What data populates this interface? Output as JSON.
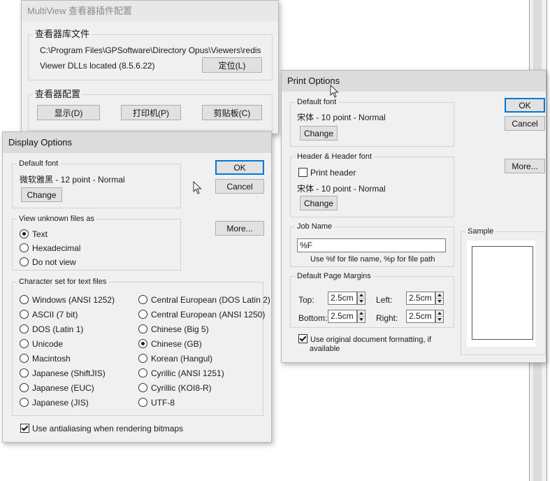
{
  "multiview": {
    "title": "MultiView 查看器插件配置",
    "lib_group": "查看器库文件",
    "path": "C:\\Program Files\\GPSoftware\\Directory Opus\\Viewers\\redis",
    "dll_status": "Viewer DLLs located (8.5.6.22)",
    "locate_button": "定位(L)",
    "config_group": "查看器配置",
    "display_button": "显示(D)",
    "printer_button": "打印机(P)",
    "clipboard_button": "剪贴板(C)"
  },
  "display": {
    "title": "Display Options",
    "default_font_group": "Default font",
    "font_value": "微软雅黑 - 12 point - Normal",
    "change_button": "Change",
    "ok_button": "OK",
    "cancel_button": "Cancel",
    "more_button": "More...",
    "view_unknown_group": "View unknown files as",
    "view_options": [
      {
        "label": "Text",
        "selected": true
      },
      {
        "label": "Hexadecimal",
        "selected": false
      },
      {
        "label": "Do not view",
        "selected": false
      }
    ],
    "charset_group": "Character set for text files",
    "charset_left": [
      {
        "label": "Windows (ANSI 1252)",
        "selected": false
      },
      {
        "label": "ASCII (7 bit)",
        "selected": false
      },
      {
        "label": "DOS (Latin 1)",
        "selected": false
      },
      {
        "label": "Unicode",
        "selected": false
      },
      {
        "label": "Macintosh",
        "selected": false
      },
      {
        "label": "Japanese (ShiftJIS)",
        "selected": false
      },
      {
        "label": "Japanese (EUC)",
        "selected": false
      },
      {
        "label": "Japanese (JIS)",
        "selected": false
      }
    ],
    "charset_right": [
      {
        "label": "Central European (DOS Latin 2)",
        "selected": false
      },
      {
        "label": "Central European (ANSI 1250)",
        "selected": false
      },
      {
        "label": "Chinese (Big 5)",
        "selected": false
      },
      {
        "label": "Chinese (GB)",
        "selected": true
      },
      {
        "label": "Korean (Hangul)",
        "selected": false
      },
      {
        "label": "Cyrillic (ANSI 1251)",
        "selected": false
      },
      {
        "label": "Cyrillic (KOI8-R)",
        "selected": false
      },
      {
        "label": "UTF-8",
        "selected": false
      }
    ],
    "antialias_label": "Use antialiasing when rendering bitmaps",
    "antialias_checked": true
  },
  "print": {
    "title": "Print Options",
    "default_font_group": "Default font",
    "font_value": "宋体 - 10 point - Normal",
    "change_button": "Change",
    "ok_button": "OK",
    "cancel_button": "Cancel",
    "more_button": "More...",
    "header_group": "Header & Header font",
    "print_header_label": "Print header",
    "print_header_checked": false,
    "header_font_value": "宋体 - 10 point - Normal",
    "header_change_button": "Change",
    "job_group": "Job Name",
    "job_value": "%F",
    "job_hint": "Use %f for file name, %p for file path",
    "margins_group": "Default Page Margins",
    "top_label": "Top:",
    "top_value": "2.5cm",
    "left_label": "Left:",
    "left_value": "2.5cm",
    "bottom_label": "Bottom:",
    "bottom_value": "2.5cm",
    "right_label": "Right:",
    "right_value": "2.5cm",
    "original_format_label_1": "Use original document formatting, if",
    "original_format_label_2": "available",
    "original_format_checked": true,
    "sample_group": "Sample"
  },
  "colors": {
    "dialog_bg": "#f0f0f0",
    "titlebar_bg": "#dcdcdc",
    "accent_focus": "#0078d7"
  }
}
